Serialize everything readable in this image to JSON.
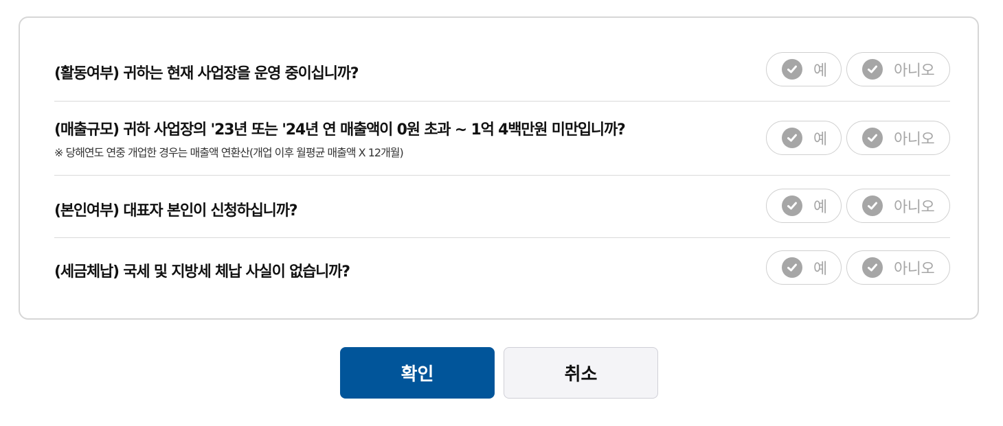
{
  "questions": [
    {
      "text": "(활동여부) 귀하는 현재 사업장을 운영 중이십니까?",
      "note": "",
      "yes": "예",
      "no": "아니오"
    },
    {
      "text": "(매출규모) 귀하 사업장의 '23년 또는 '24년 연 매출액이 0원 초과 ~ 1억 4백만원 미만입니까?",
      "note": "※ 당해연도 연중 개업한 경우는 매출액 연환산(개업 이후 월평균 매출액 X 12개월)",
      "yes": "예",
      "no": "아니오"
    },
    {
      "text": "(본인여부) 대표자 본인이 신청하십니까?",
      "note": "",
      "yes": "예",
      "no": "아니오"
    },
    {
      "text": "(세금체납) 국세 및 지방세 체납 사실이 없습니까?",
      "note": "",
      "yes": "예",
      "no": "아니오"
    }
  ],
  "actions": {
    "confirm_label": "확인",
    "cancel_label": "취소"
  },
  "colors": {
    "primary": "#01559a",
    "inactive": "#a6a6a6"
  }
}
